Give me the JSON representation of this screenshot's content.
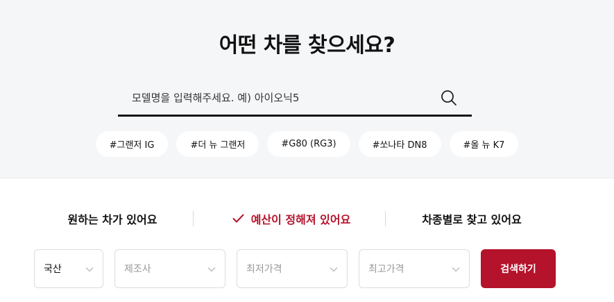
{
  "hero": {
    "title": "어떤 차를 찾으세요?",
    "search": {
      "placeholder": "모델명을 입력해주세요. 예) 아이오닉5",
      "value": ""
    },
    "tags": [
      "#그랜저 IG",
      "#더 뉴 그랜저",
      "#G80 (RG3)",
      "#쏘나타 DN8",
      "#올 뉴 K7"
    ]
  },
  "tabs": {
    "items": [
      {
        "label": "원하는 차가 있어요",
        "active": false
      },
      {
        "label": "예산이 정해져 있어요",
        "active": true
      },
      {
        "label": "차종별로 찾고 있어요",
        "active": false
      }
    ]
  },
  "filters": {
    "origin": "국산",
    "maker": "제조사",
    "min_price": "최저가격",
    "max_price": "최고가격",
    "submit_label": "검색하기"
  },
  "colors": {
    "accent": "#b5122b",
    "hero_bg": "#f5f6f8"
  },
  "icons": {
    "search": "search-icon",
    "check": "check-icon",
    "dropdown": "chevron-down-icon"
  }
}
